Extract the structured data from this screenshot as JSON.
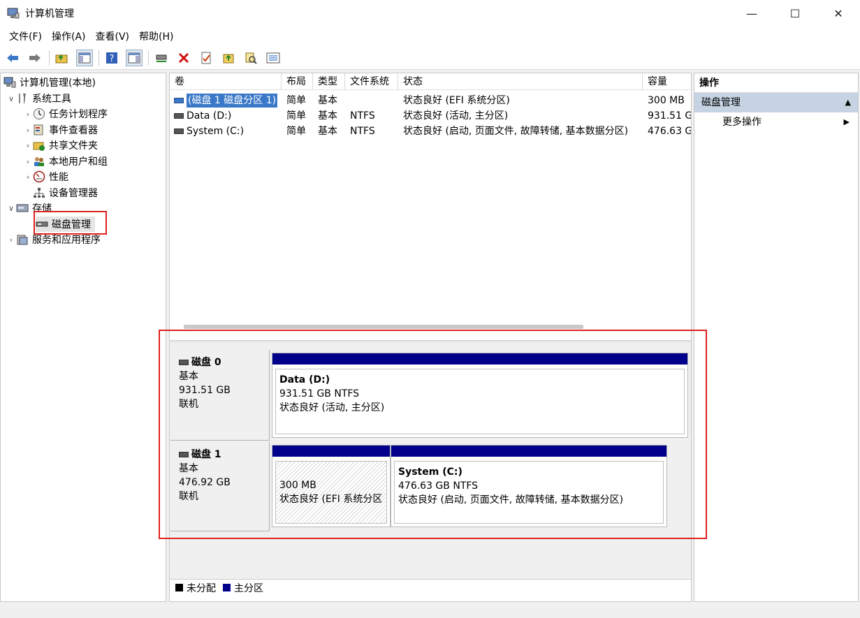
{
  "window": {
    "title": "计算机管理",
    "minimize": "—",
    "maximize": "☐",
    "close": "✕"
  },
  "menu": [
    "文件(F)",
    "操作(A)",
    "查看(V)",
    "帮助(H)"
  ],
  "tree": {
    "root": "计算机管理(本地)",
    "system_tools": "系统工具",
    "task_scheduler": "任务计划程序",
    "event_viewer": "事件查看器",
    "shared_folders": "共享文件夹",
    "local_users": "本地用户和组",
    "performance": "性能",
    "device_manager": "设备管理器",
    "storage": "存储",
    "disk_management": "磁盘管理",
    "services_apps": "服务和应用程序"
  },
  "volumes": {
    "headers": [
      "卷",
      "布局",
      "类型",
      "文件系统",
      "状态",
      "容量"
    ],
    "rows": [
      {
        "vol": "(磁盘 1 磁盘分区 1)",
        "layout": "简单",
        "type": "基本",
        "fs": "",
        "status": "状态良好 (EFI 系统分区)",
        "cap": "300 MB"
      },
      {
        "vol": "Data (D:)",
        "layout": "简单",
        "type": "基本",
        "fs": "NTFS",
        "status": "状态良好 (活动, 主分区)",
        "cap": "931.51 G"
      },
      {
        "vol": "System (C:)",
        "layout": "简单",
        "type": "基本",
        "fs": "NTFS",
        "status": "状态良好 (启动, 页面文件, 故障转储, 基本数据分区)",
        "cap": "476.63 G"
      }
    ]
  },
  "disks": [
    {
      "name": "磁盘 0",
      "type": "基本",
      "size": "931.51 GB",
      "state": "联机"
    },
    {
      "name": "磁盘 1",
      "type": "基本",
      "size": "476.92 GB",
      "state": "联机"
    }
  ],
  "partitions": {
    "data": {
      "name": "Data  (D:)",
      "size": "931.51 GB NTFS",
      "status": "状态良好 (活动, 主分区)"
    },
    "efi": {
      "size": "300 MB",
      "status": "状态良好 (EFI 系统分区"
    },
    "system": {
      "name": "System  (C:)",
      "size": "476.63 GB NTFS",
      "status": "状态良好 (启动, 页面文件, 故障转储, 基本数据分区)"
    }
  },
  "legend": {
    "unallocated": "未分配",
    "primary": "主分区"
  },
  "actions": {
    "header": "操作",
    "section": "磁盘管理",
    "more": "更多操作"
  },
  "colors": {
    "primary_partition": "#00008b",
    "unallocated": "#000000",
    "highlight": "#e02020"
  }
}
